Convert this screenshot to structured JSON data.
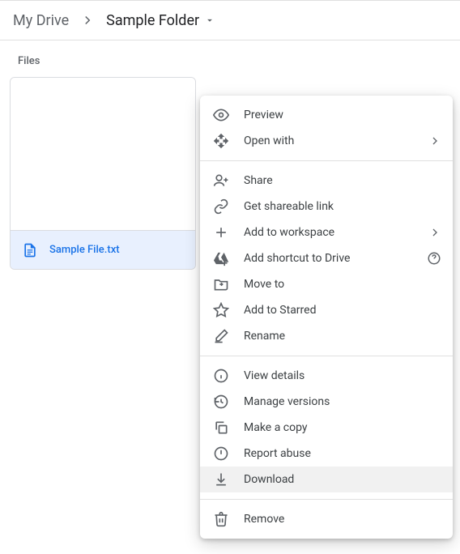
{
  "breadcrumb": {
    "root": "My Drive",
    "current": "Sample Folder"
  },
  "section_label": "Files",
  "file": {
    "name": "Sample File.txt"
  },
  "menu": {
    "preview": "Preview",
    "open_with": "Open with",
    "share": "Share",
    "get_link": "Get shareable link",
    "add_workspace": "Add to workspace",
    "add_shortcut": "Add shortcut to Drive",
    "move_to": "Move to",
    "add_starred": "Add to Starred",
    "rename": "Rename",
    "view_details": "View details",
    "manage_versions": "Manage versions",
    "make_copy": "Make a copy",
    "report_abuse": "Report abuse",
    "download": "Download",
    "remove": "Remove"
  }
}
